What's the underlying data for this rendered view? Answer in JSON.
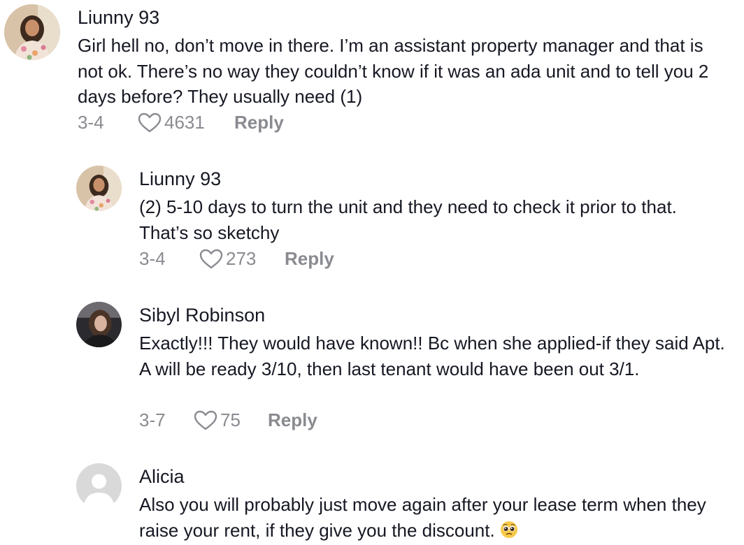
{
  "comments": [
    {
      "username": "Liunny 93",
      "text": "Girl hell no, don’t move in there. I’m an assistant property manager and that is not ok. There’s no way they couldn’t know if it was an ada unit and to tell you 2 days before? They usually need (1)",
      "date": "3-4",
      "likes": "4631",
      "reply_label": "Reply",
      "avatar_icon": "profile-photo"
    },
    {
      "username": "Liunny 93",
      "text": "(2) 5-10 days to turn the unit and they need to check it prior to that. That’s so sketchy",
      "date": "3-4",
      "likes": "273",
      "reply_label": "Reply",
      "avatar_icon": "profile-photo"
    },
    {
      "username": "Sibyl Robinson",
      "text": "Exactly!!! They would have known!! Bc when she applied-if they said Apt. A will be ready 3/10, then last tenant would have been out 3/1.",
      "date": "3-7",
      "likes": "75",
      "reply_label": "Reply",
      "avatar_icon": "profile-photo"
    },
    {
      "username": "Alicia",
      "text": "Also you will probably just move again after your lease term when they raise your rent, if they give you the discount.",
      "emoji": "pleading-face-emoji",
      "avatar_icon": "default-avatar-icon"
    }
  ],
  "colors": {
    "text": "#161823",
    "meta": "#8a8b91",
    "default_avatar_bg": "#d9d9d9"
  }
}
